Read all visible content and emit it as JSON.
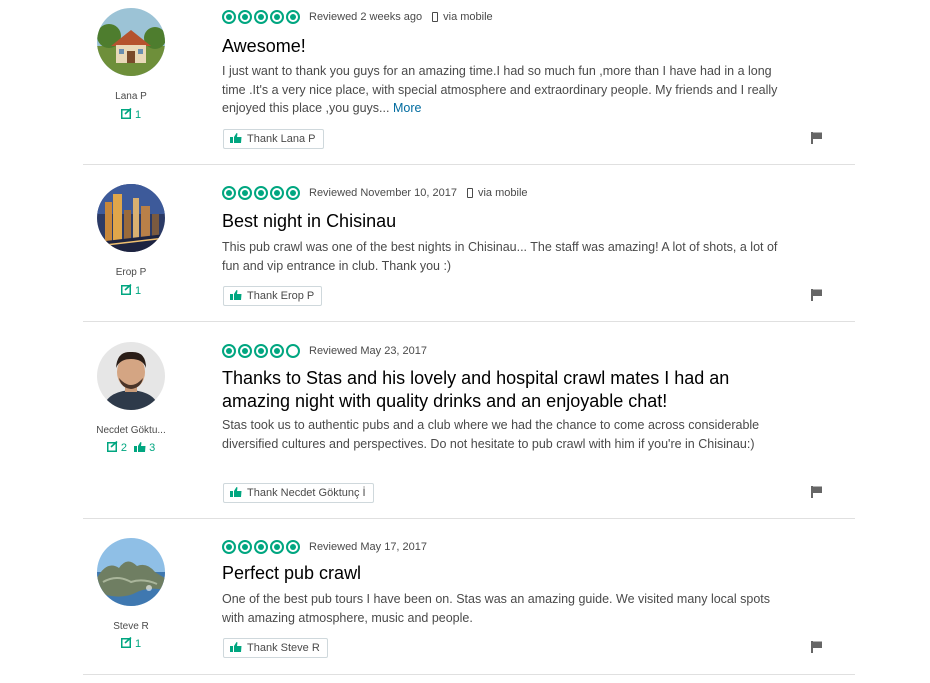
{
  "colors": {
    "accent": "#00a680",
    "link": "#006b9f",
    "text": "#4a4a4a",
    "title": "#000000"
  },
  "reviews": [
    {
      "user": {
        "name": "Lana P",
        "reviews": "1",
        "avatar_icon": "house-photo-avatar"
      },
      "rating": 5,
      "date": "Reviewed 2 weeks ago",
      "mobile": "via mobile",
      "title": "Awesome!",
      "body": "I just want to thank you guys for an amazing time.I had so much fun ,more than I have had in a long time .It's a very nice place, with special atmosphere and extraordinary people. My friends and I really enjoyed this place ,you guys...",
      "more": "More",
      "thank": "Thank Lana P"
    },
    {
      "user": {
        "name": "Erop P",
        "reviews": "1",
        "avatar_icon": "city-night-avatar"
      },
      "rating": 5,
      "date": "Reviewed November 10, 2017",
      "mobile": "via mobile",
      "title": "Best night in Chisinau",
      "body": "This pub crawl was one of the best nights in Chisinau... The staff was amazing! A lot of shots, a lot of fun and vip entrance in club. Thank you :)",
      "thank": "Thank Erop P"
    },
    {
      "user": {
        "name": "Necdet Göktu...",
        "reviews": "2",
        "helpful": "3",
        "avatar_icon": "man-portrait-avatar"
      },
      "rating": 4,
      "date": "Reviewed May 23, 2017",
      "title_line1": "Thanks to Stas and his lovely and hospital crawl mates I had an",
      "title_line2": "amazing night with quality drinks and an enjoyable chat!",
      "body": "Stas took us to authentic pubs and a club where we had the chance to come across considerable diversified cultures and perspectives. Do not hesitate to pub crawl with him if you're in Chisinau:)",
      "thank": "Thank Necdet Göktunç İ"
    },
    {
      "user": {
        "name": "Steve R",
        "reviews": "1",
        "avatar_icon": "coast-landscape-avatar"
      },
      "rating": 5,
      "date": "Reviewed May 17, 2017",
      "title": "Perfect pub crawl",
      "body": "One of the best pub tours I have been on. Stas was an amazing guide. We visited many local spots with amazing atmosphere, music and people.",
      "thank": "Thank Steve R"
    }
  ]
}
